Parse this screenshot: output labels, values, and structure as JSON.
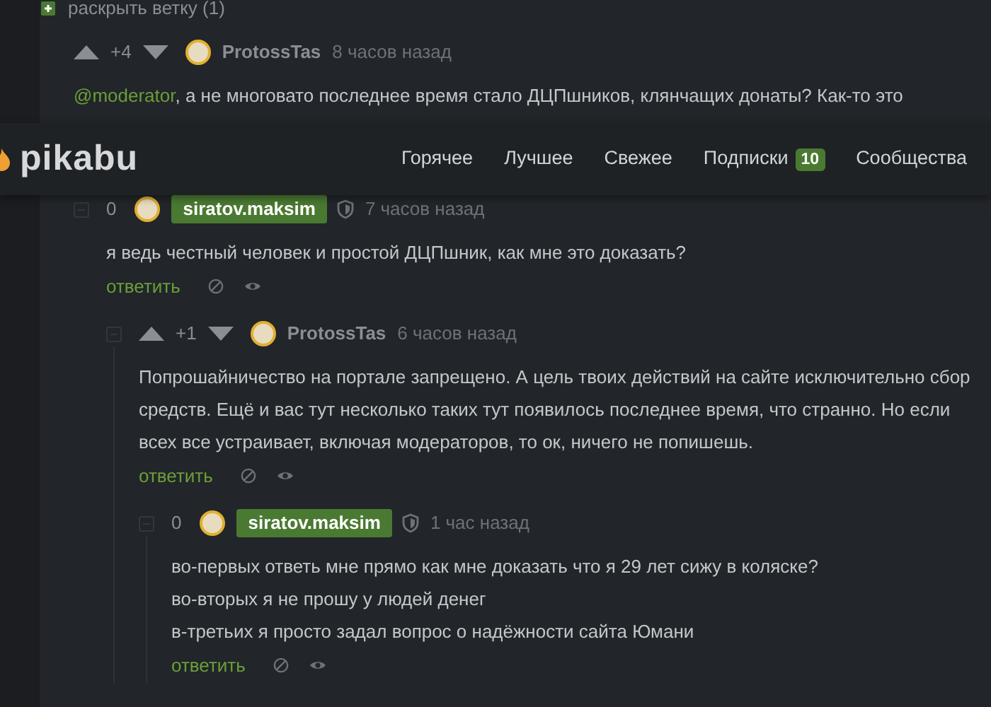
{
  "expand_branch": {
    "label": "раскрыть ветку (1)"
  },
  "header": {
    "logo": "pikabu",
    "nav": [
      {
        "label": "Горячее"
      },
      {
        "label": "Лучшее"
      },
      {
        "label": "Свежее"
      },
      {
        "label": "Подписки",
        "badge": "10"
      },
      {
        "label": "Сообщества"
      }
    ]
  },
  "comments": [
    {
      "kind": "rated",
      "rating": "+4",
      "author": "ProtossTas",
      "time": "8 часов назад",
      "mention": "@moderator",
      "text": ", а не многовато последнее время стало ДЦПшников, клянчащих донаты? Как-то это",
      "children": [
        {
          "kind": "own",
          "rating": "0",
          "author": "siratov.maksim",
          "time": "7 часов назад",
          "lines": [
            "я ведь честный человек и простой ДЦПшник, как мне это доказать?"
          ],
          "reply": "ответить",
          "children": [
            {
              "kind": "rated",
              "rating": "+1",
              "author": "ProtossTas",
              "time": "6 часов назад",
              "lines": [
                "Попрошайничество на портале запрещено. А цель твоих действий на сайте исключительно сбор средств. Ещё и вас тут несколько таких тут появилось последнее время, что странно. Но если всех все устраивает, включая модераторов, то ок, ничего не попишешь."
              ],
              "reply": "ответить",
              "children": [
                {
                  "kind": "own",
                  "rating": "0",
                  "author": "siratov.maksim",
                  "time": "1 час назад",
                  "lines": [
                    "во-первых ответь мне прямо как мне доказать что я 29 лет сижу в коляске?",
                    "во-вторых я не прошу у людей денег",
                    "в-третьих я просто задал вопрос о надёжности сайта Юмани"
                  ],
                  "reply": "ответить"
                }
              ]
            }
          ]
        }
      ]
    }
  ]
}
